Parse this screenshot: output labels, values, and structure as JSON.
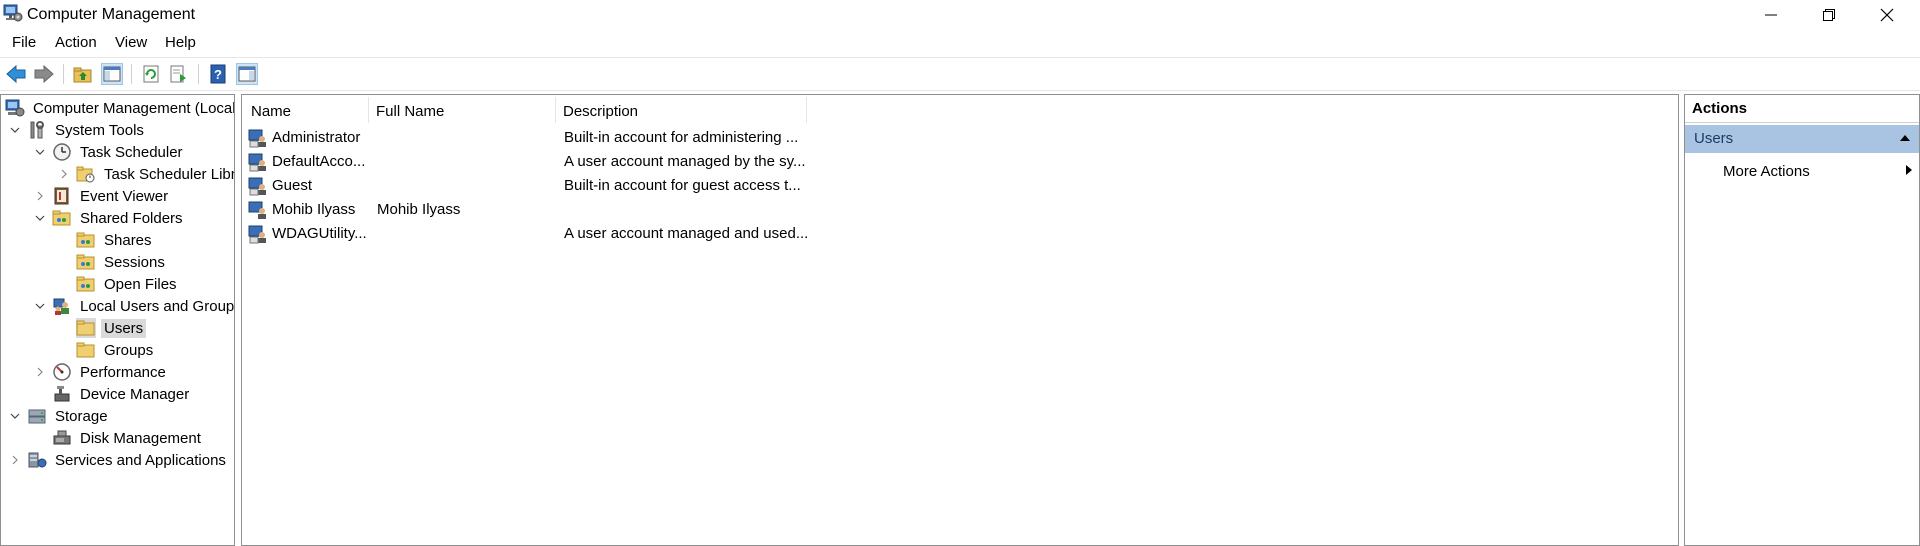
{
  "window": {
    "title": "Computer Management",
    "minimize_icon": "minimize-icon",
    "maximize_icon": "restore-icon",
    "close_icon": "close-icon"
  },
  "menu": [
    "File",
    "Action",
    "View",
    "Help"
  ],
  "toolbar": {
    "icons": [
      "back-arrow-icon",
      "forward-arrow-icon",
      "up-folder-icon",
      "show-hide-console-tree-icon",
      "refresh-icon",
      "export-list-icon",
      "help-icon",
      "show-hide-action-pane-icon"
    ]
  },
  "tree": {
    "root": "Computer Management (Local)",
    "system_tools": "System Tools",
    "task_scheduler": "Task Scheduler",
    "task_scheduler_library": "Task Scheduler Libra",
    "event_viewer": "Event Viewer",
    "shared_folders": "Shared Folders",
    "shares": "Shares",
    "sessions": "Sessions",
    "open_files": "Open Files",
    "local_users_groups": "Local Users and Groups",
    "users": "Users",
    "groups": "Groups",
    "performance": "Performance",
    "device_manager": "Device Manager",
    "storage": "Storage",
    "disk_management": "Disk Management",
    "services_apps": "Services and Applications"
  },
  "list": {
    "columns": [
      "Name",
      "Full Name",
      "Description"
    ],
    "rows": [
      {
        "name": "Administrator",
        "full_name": "",
        "description": "Built-in account for administering ..."
      },
      {
        "name": "DefaultAcco...",
        "full_name": "",
        "description": "A user account managed by the sy..."
      },
      {
        "name": "Guest",
        "full_name": "",
        "description": "Built-in account for guest access t..."
      },
      {
        "name": "Mohib Ilyass",
        "full_name": "Mohib Ilyass",
        "description": ""
      },
      {
        "name": "WDAGUtility...",
        "full_name": "",
        "description": "A user account managed and used..."
      }
    ]
  },
  "actions": {
    "header": "Actions",
    "group": "Users",
    "more_actions": "More Actions"
  },
  "colors": {
    "selection": "#d9d9d9",
    "action_group_bg": "#a9c4e3",
    "pane_border": "#8f8f8f"
  }
}
